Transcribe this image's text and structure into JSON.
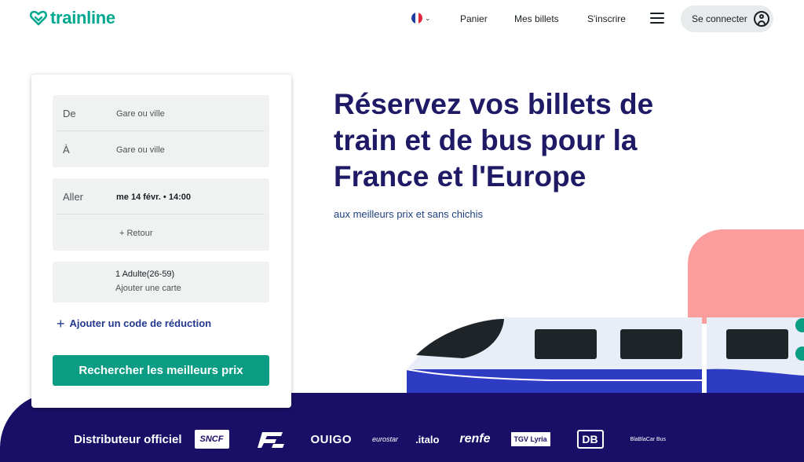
{
  "header": {
    "brand": "trainline",
    "language_icon": "france-flag-icon",
    "nav": [
      {
        "label": "Panier"
      },
      {
        "label": "Mes billets"
      },
      {
        "label": "S'inscrire"
      }
    ],
    "menu_icon": "hamburger-menu-icon",
    "connect_label": "Se connecter",
    "connect_icon": "user-circle-icon"
  },
  "search": {
    "from_label": "De",
    "from_placeholder": "Gare ou ville",
    "to_label": "À",
    "to_placeholder": "Gare ou ville",
    "outbound_label": "Aller",
    "outbound_value": "me 14 févr. • 14:00",
    "return_label": "+ Retour",
    "passengers": "1 Adulte(26-59)",
    "add_card": "Ajouter une carte",
    "promo": "Ajouter un code de réduction",
    "submit": "Rechercher les meilleurs prix"
  },
  "hero": {
    "title": "Réservez vos billets de train et de bus pour la France et l'Europe",
    "subtitle": "aux meilleurs prix et sans chichis"
  },
  "partners": {
    "label": "Distributeur officiel",
    "logos": [
      "SNCF",
      "FS",
      "OUIGO",
      "eurostar",
      ".italo",
      "renfe",
      "TGV Lyria",
      "DB",
      "BlaBlaCar Bus"
    ]
  },
  "colors": {
    "brand_green": "#00a88f",
    "cta_green": "#0b9c84",
    "hero_navy": "#1e1a66",
    "band_navy": "#1a0f66",
    "illustration_pink": "#fc9d9d"
  }
}
